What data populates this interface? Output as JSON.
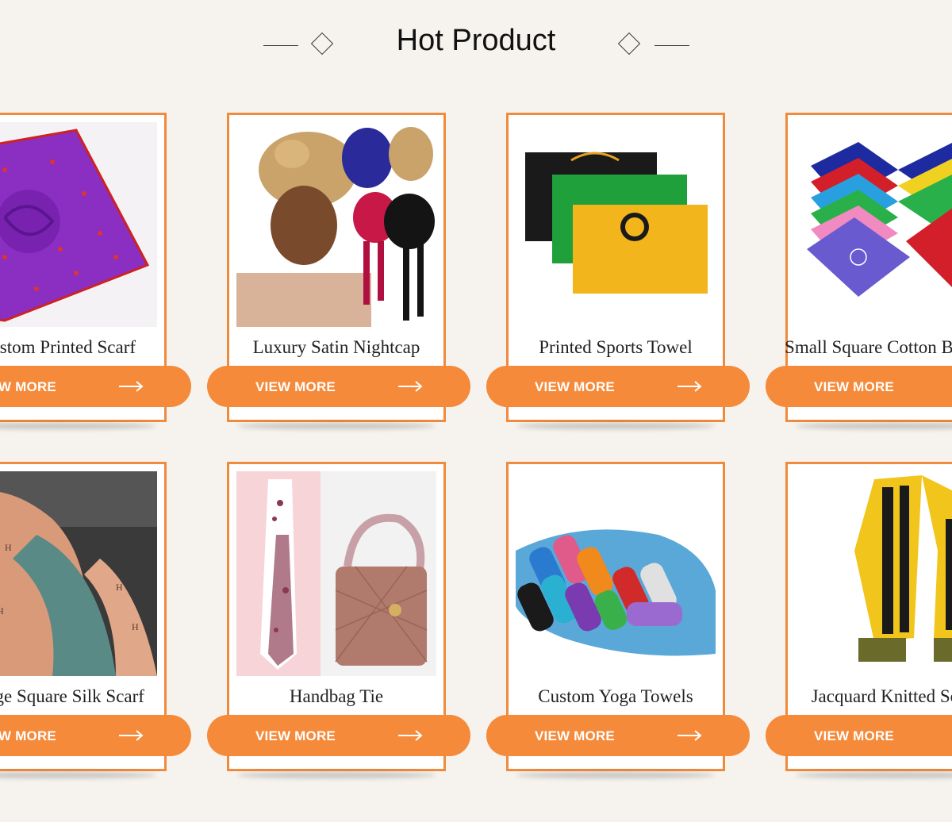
{
  "section": {
    "title": "Hot Product"
  },
  "theme": {
    "accent": "#f58a3a",
    "border": "#f08a3c",
    "background": "#f6f3ee"
  },
  "products": [
    {
      "title": "Custom Printed Scarf",
      "button": "VIEW MORE",
      "image": "purple-printed-silk-scarf"
    },
    {
      "title": "Luxury Satin Nightcap",
      "button": "VIEW MORE",
      "image": "satin-bonnets"
    },
    {
      "title": "Printed Sports Towel",
      "button": "VIEW MORE",
      "image": "printed-sports-towels"
    },
    {
      "title": "Small Square Cotton Bandana",
      "button": "VIEW MORE",
      "image": "paisley-bandanas"
    },
    {
      "title": "Large Square Silk Scarf",
      "button": "VIEW MORE",
      "image": "teal-pink-silk-scarf"
    },
    {
      "title": "Handbag Tie",
      "button": "VIEW MORE",
      "image": "handbag-twilly-scarf"
    },
    {
      "title": "Custom Yoga Towels",
      "button": "VIEW MORE",
      "image": "rolled-cooling-towels"
    },
    {
      "title": "Jacquard Knitted Scarf",
      "button": "VIEW MORE",
      "image": "knitted-football-scarf"
    }
  ]
}
